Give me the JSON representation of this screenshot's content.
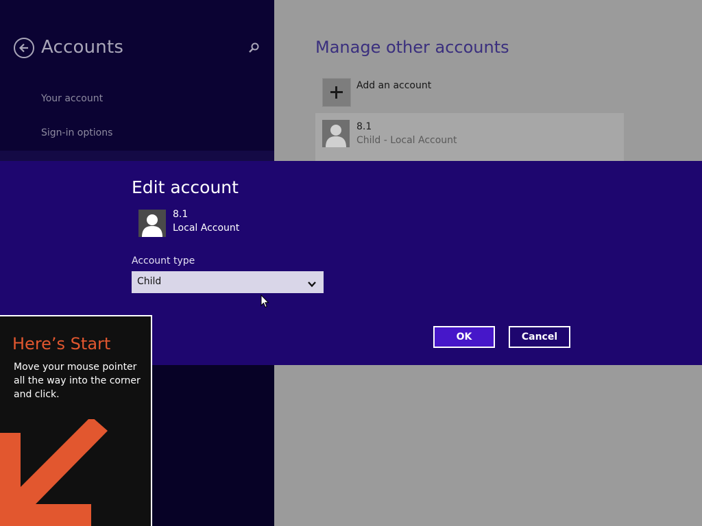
{
  "sidebar": {
    "title": "Accounts",
    "items": [
      {
        "label": "Your account"
      },
      {
        "label": "Sign-in options"
      }
    ]
  },
  "manage": {
    "title": "Manage other accounts",
    "add_label": "Add an account",
    "account": {
      "name": "8.1",
      "type": "Child - Local Account"
    }
  },
  "dialog": {
    "title": "Edit account",
    "account_name": "8.1",
    "account_kind": "Local Account",
    "field_label": "Account type",
    "selected_value": "Child",
    "ok_label": "OK",
    "cancel_label": "Cancel"
  },
  "tip": {
    "title": "Here’s Start",
    "body": "Move your mouse pointer all the way into the corner and click."
  },
  "icons": {
    "back": "back-arrow-circle-icon",
    "search": "search-icon",
    "add": "plus-icon",
    "avatar": "user-avatar-icon",
    "dropdown": "chevron-down-icon",
    "pointer": "mouse-pointer-icon",
    "tip_arrow": "arrow-down-left-icon"
  },
  "colors": {
    "dialog_bg": "#1e066f",
    "ok_button": "#4617c9",
    "tip_accent": "#e2572f",
    "sidebar_bg": "#070226"
  }
}
